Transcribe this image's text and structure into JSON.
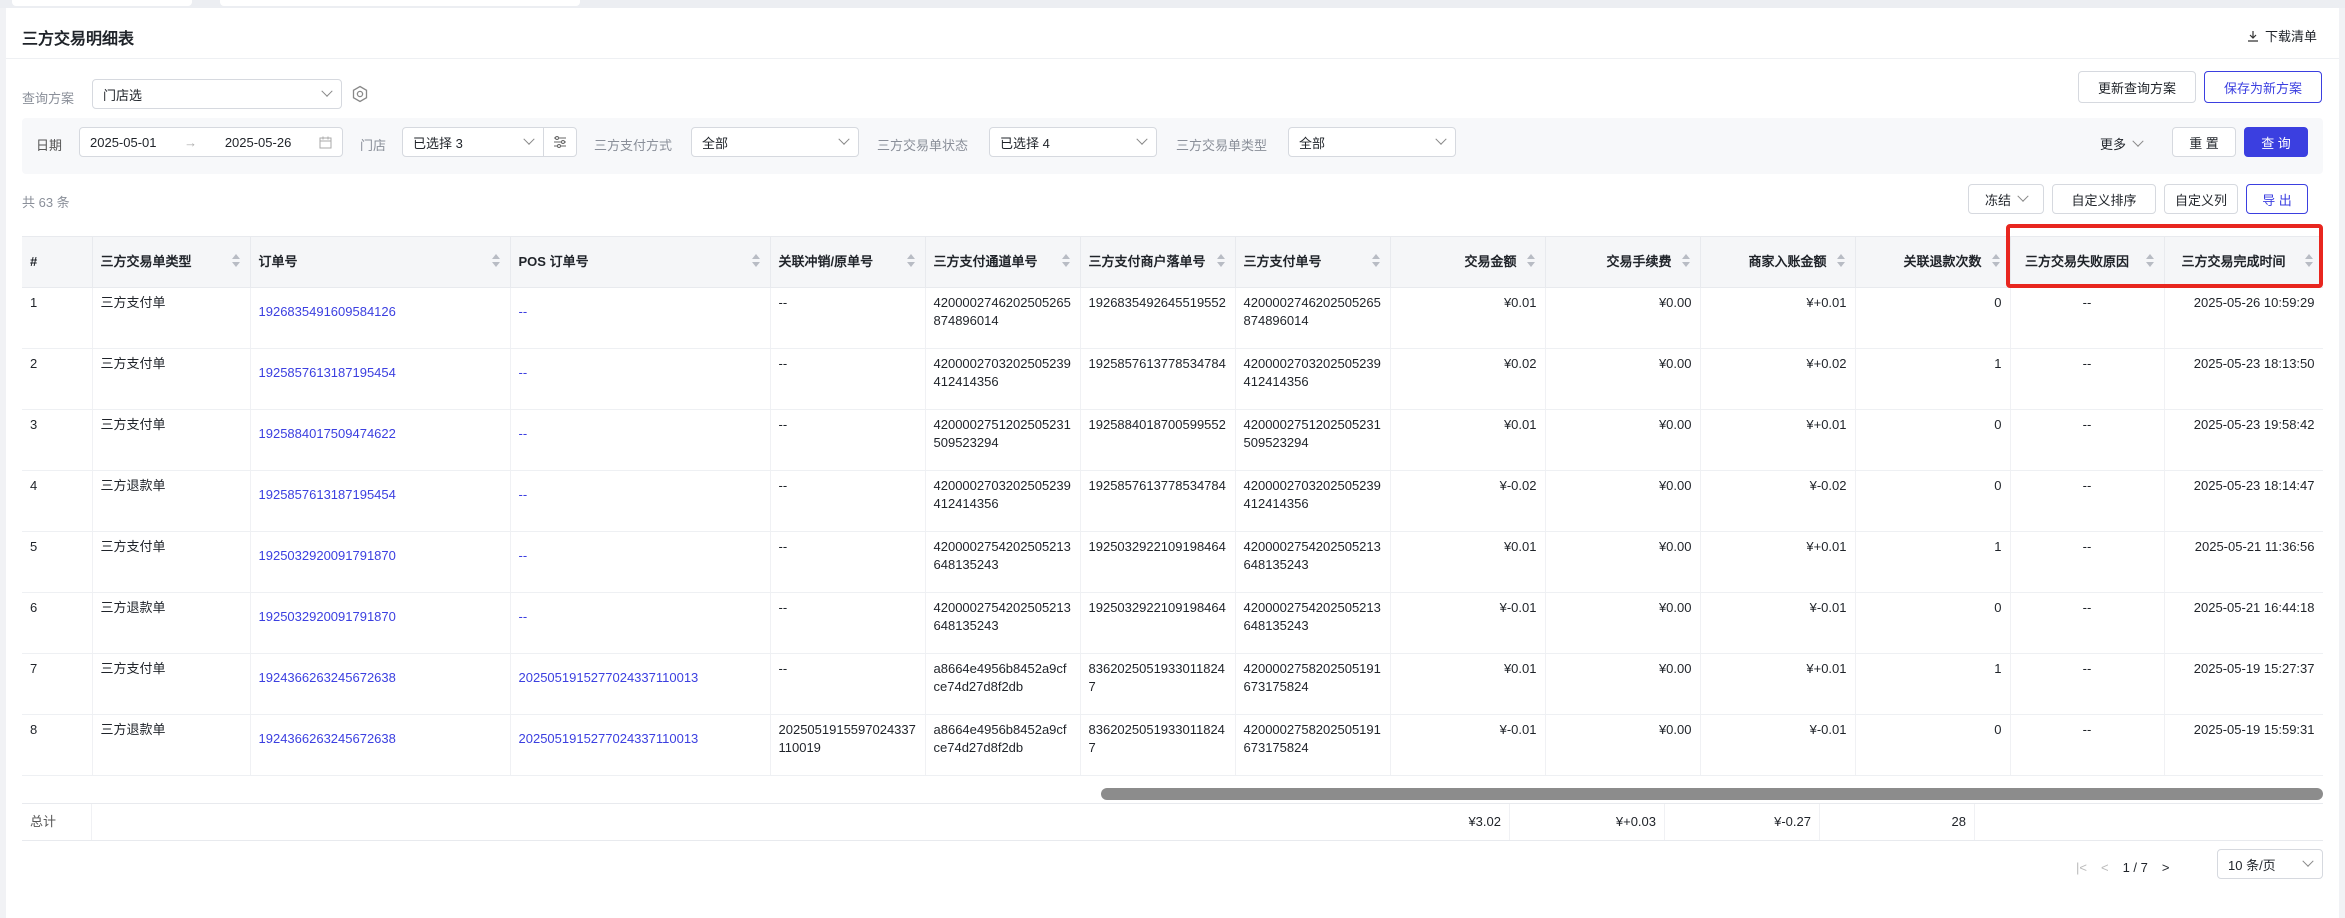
{
  "page": {
    "title": "三方交易明细表",
    "download": "下载清单"
  },
  "scheme": {
    "label": "查询方案",
    "value": "门店选",
    "update_btn": "更新查询方案",
    "save_btn": "保存为新方案"
  },
  "filters": {
    "date_label": "日期",
    "date_start": "2025-05-01",
    "date_end": "2025-05-26",
    "store_label": "门店",
    "store_value": "已选择 3",
    "pay_label": "三方支付方式",
    "pay_value": "全部",
    "status_label": "三方交易单状态",
    "status_value": "已选择 4",
    "type_label": "三方交易单类型",
    "type_value": "全部",
    "more": "更多",
    "reset": "重 置",
    "query": "查 询"
  },
  "toolbar": {
    "count": "共 63 条",
    "freeze": "冻结",
    "custom_sort": "自定义排序",
    "custom_cols": "自定义列",
    "export": "导 出"
  },
  "columns": [
    "#",
    "三方交易单类型",
    "订单号",
    "POS 订单号",
    "关联冲销/原单号",
    "三方支付通道单号",
    "三方支付商户落单号",
    "三方支付单号",
    "交易金额",
    "交易手续费",
    "商家入账金额",
    "关联退款次数",
    "三方交易失败原因",
    "三方交易完成时间"
  ],
  "rows": [
    {
      "n": "1",
      "type": "三方支付单",
      "order": "1926835491609584126",
      "pos": "--",
      "rel": "--",
      "ch": "4200002746202505265874896014",
      "merch": "1926835492645519552",
      "pay": "4200002746202505265874896014",
      "amt": "¥0.01",
      "fee": "¥0.00",
      "net": "¥+0.01",
      "refunds": "0",
      "reason": "--",
      "time": "2025-05-26 10:59:29"
    },
    {
      "n": "2",
      "type": "三方支付单",
      "order": "1925857613187195454",
      "pos": "--",
      "rel": "--",
      "ch": "4200002703202505239412414356",
      "merch": "1925857613778534784",
      "pay": "4200002703202505239412414356",
      "amt": "¥0.02",
      "fee": "¥0.00",
      "net": "¥+0.02",
      "refunds": "1",
      "reason": "--",
      "time": "2025-05-23 18:13:50"
    },
    {
      "n": "3",
      "type": "三方支付单",
      "order": "1925884017509474622",
      "pos": "--",
      "rel": "--",
      "ch": "4200002751202505231509523294",
      "merch": "1925884018700599552",
      "pay": "4200002751202505231509523294",
      "amt": "¥0.01",
      "fee": "¥0.00",
      "net": "¥+0.01",
      "refunds": "0",
      "reason": "--",
      "time": "2025-05-23 19:58:42"
    },
    {
      "n": "4",
      "type": "三方退款单",
      "order": "1925857613187195454",
      "pos": "--",
      "rel": "--",
      "ch": "4200002703202505239412414356",
      "merch": "1925857613778534784",
      "pay": "4200002703202505239412414356",
      "amt": "¥-0.02",
      "fee": "¥0.00",
      "net": "¥-0.02",
      "refunds": "0",
      "reason": "--",
      "time": "2025-05-23 18:14:47"
    },
    {
      "n": "5",
      "type": "三方支付单",
      "order": "1925032920091791870",
      "pos": "--",
      "rel": "--",
      "ch": "4200002754202505213648135243",
      "merch": "1925032922109198464",
      "pay": "4200002754202505213648135243",
      "amt": "¥0.01",
      "fee": "¥0.00",
      "net": "¥+0.01",
      "refunds": "1",
      "reason": "--",
      "time": "2025-05-21 11:36:56"
    },
    {
      "n": "6",
      "type": "三方退款单",
      "order": "1925032920091791870",
      "pos": "--",
      "rel": "--",
      "ch": "4200002754202505213648135243",
      "merch": "1925032922109198464",
      "pay": "4200002754202505213648135243",
      "amt": "¥-0.01",
      "fee": "¥0.00",
      "net": "¥-0.01",
      "refunds": "0",
      "reason": "--",
      "time": "2025-05-21 16:44:18"
    },
    {
      "n": "7",
      "type": "三方支付单",
      "order": "1924366263245672638",
      "pos": "2025051915277024337110013",
      "rel": "--",
      "ch": "a8664e4956b8452a9cfce74d27d8f2db",
      "merch": "83620250519330118247",
      "pay": "4200002758202505191673175824",
      "amt": "¥0.01",
      "fee": "¥0.00",
      "net": "¥+0.01",
      "refunds": "1",
      "reason": "--",
      "time": "2025-05-19 15:27:37"
    },
    {
      "n": "8",
      "type": "三方退款单",
      "order": "1924366263245672638",
      "pos": "2025051915277024337110013",
      "rel": "2025051915597024337110019",
      "ch": "a8664e4956b8452a9cfce74d27d8f2db",
      "merch": "83620250519330118247",
      "pay": "4200002758202505191673175824",
      "amt": "¥-0.01",
      "fee": "¥0.00",
      "net": "¥-0.01",
      "refunds": "0",
      "reason": "--",
      "time": "2025-05-19 15:59:31"
    }
  ],
  "totals": {
    "label": "总计",
    "amt": "¥3.02",
    "fee": "¥+0.03",
    "net": "¥-0.27",
    "refunds": "28"
  },
  "pager": {
    "page": "1",
    "sep": "/",
    "total": "7",
    "size": "10 条/页"
  },
  "colors": {
    "accent": "#3b3fe0",
    "highlight": "#e8261f"
  }
}
